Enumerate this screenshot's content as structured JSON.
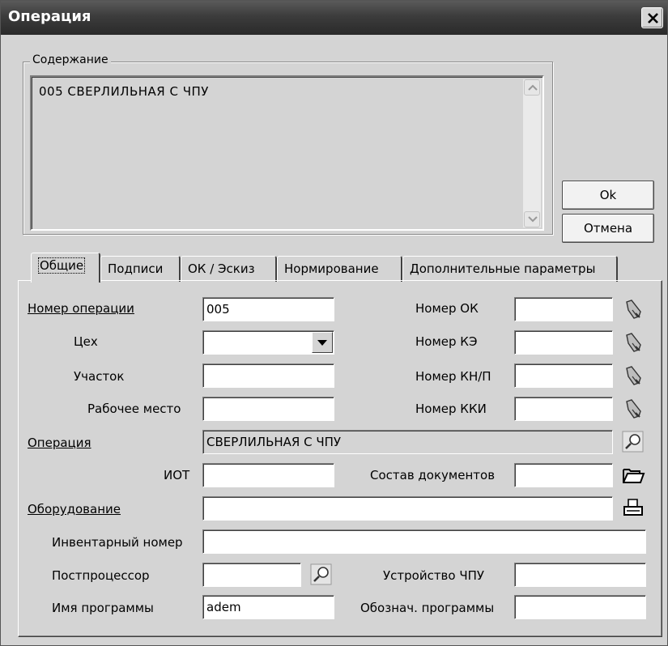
{
  "window": {
    "title": "Операция"
  },
  "content": {
    "legend": "Содержание",
    "text": "005  СВЕРЛИЛЬНАЯ С ЧПУ"
  },
  "buttons": {
    "ok": "Ok",
    "cancel": "Отмена"
  },
  "tabs": [
    {
      "label": "Общие",
      "active": true
    },
    {
      "label": "Подписи"
    },
    {
      "label": "ОК / Эскиз"
    },
    {
      "label": "Нормирование"
    },
    {
      "label": "Дополнительные параметры"
    }
  ],
  "form": {
    "op_number": {
      "label": "Номер операции",
      "value": "005"
    },
    "shop": {
      "label": "Цех",
      "value": ""
    },
    "area": {
      "label": "Участок",
      "value": ""
    },
    "workplace": {
      "label": "Рабочее место",
      "value": ""
    },
    "ok_number": {
      "label": "Номер ОК",
      "value": ""
    },
    "ke_number": {
      "label": "Номер КЭ",
      "value": ""
    },
    "knp_number": {
      "label": "Номер КН/П",
      "value": ""
    },
    "kki_number": {
      "label": "Номер ККИ",
      "value": ""
    },
    "operation": {
      "label": "Операция",
      "value": "СВЕРЛИЛЬНАЯ С ЧПУ"
    },
    "iot": {
      "label": "ИОТ",
      "value": ""
    },
    "docs": {
      "label": "Состав документов",
      "value": ""
    },
    "equipment": {
      "label": "Оборудование",
      "value": ""
    },
    "inventory": {
      "label": "Инвентарный номер",
      "value": ""
    },
    "postprocessor": {
      "label": "Постпроцессор",
      "value": ""
    },
    "cnc_device": {
      "label": "Устройство ЧПУ",
      "value": ""
    },
    "program_name": {
      "label": "Имя программы",
      "value": "adem"
    },
    "program_code": {
      "label": "Обознач. программы",
      "value": ""
    }
  },
  "icons": {
    "lookup": "pointing-hand-icon",
    "search": "magnifier-icon",
    "folder": "open-folder-icon",
    "equipment": "printer-icon"
  }
}
